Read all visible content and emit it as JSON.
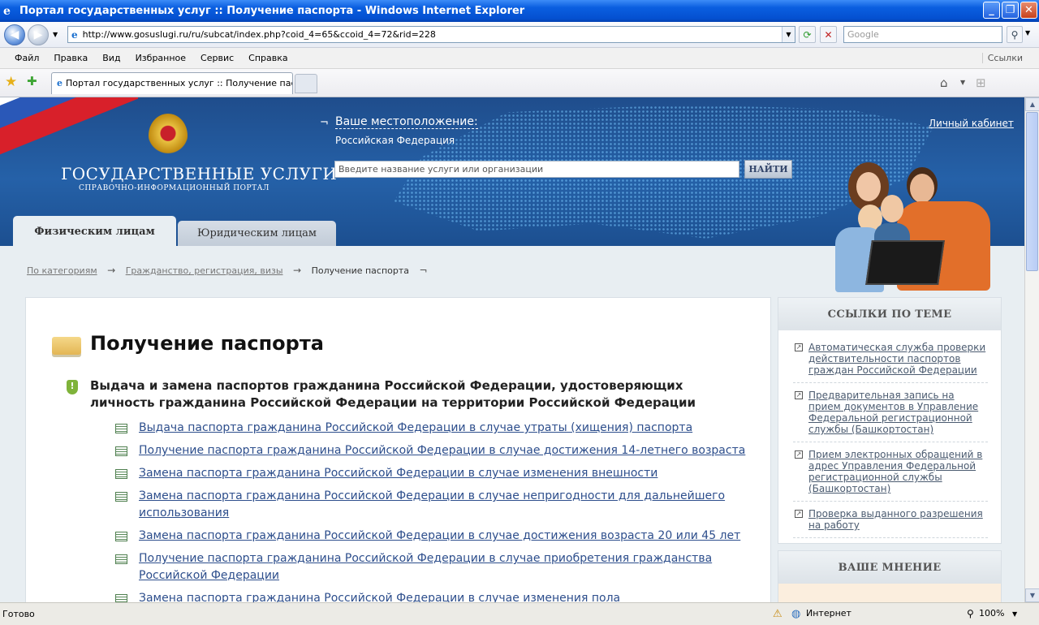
{
  "window": {
    "title": "Портал государственных услуг :: Получение паспорта - Windows Internet Explorer"
  },
  "browser": {
    "url": "http://www.gosuslugi.ru/ru/subcat/index.php?coid_4=65&ccoid_4=72&rid=228",
    "search_placeholder": "Google",
    "menu": [
      "Файл",
      "Правка",
      "Вид",
      "Избранное",
      "Сервис",
      "Справка"
    ],
    "links_label": "Ссылки",
    "tab_title": "Портал государственных услуг :: Получение пасп..."
  },
  "site": {
    "logo_title": "ГОСУДАРСТВЕННЫЕ УСЛУГИ",
    "logo_subtitle": "СПРАВОЧНО-ИНФОРМАЦИОННЫЙ ПОРТАЛ",
    "location_label": "Ваше местоположение:",
    "location_value": "Российская Федерация",
    "cabinet_link": "Личный кабинет",
    "search_placeholder": "Введите название услуги или организации",
    "search_button": "НАЙТИ",
    "tabs": [
      {
        "label": "Физическим лицам",
        "active": true
      },
      {
        "label": "Юридическим лицам",
        "active": false
      }
    ]
  },
  "breadcrumb": {
    "items": [
      "По категориям",
      "Гражданство, регистрация, визы"
    ],
    "current": "Получение паспорта"
  },
  "main": {
    "title": "Получение паспорта",
    "section_title": "Выдача и замена паспортов гражданина Российской Федерации, удостоверяющих личность гражданина Российской Федерации на территории Российской Федерации",
    "links": [
      "Выдача паспорта гражданина Российской Федерации в случае утраты (хищения) паспорта",
      "Получение паспорта гражданина Российской Федерации в случае достижения 14-летнего возраста",
      "Замена паспорта гражданина Российской Федерации в случае изменения внешности",
      "Замена паспорта гражданина Российской Федерации в случае непригодности для дальнейшего использования",
      "Замена паспорта гражданина Российской Федерации в случае достижения возраста 20 или 45 лет",
      "Получение паспорта гражданина Российской Федерации в случае приобретения гражданства Российской Федерации",
      "Замена паспорта гражданина Российской Федерации в случае изменения пола"
    ]
  },
  "sidebar": {
    "links_title": "ССЫЛКИ ПО ТЕМЕ",
    "links": [
      "Автоматическая служба проверки действительности паспортов граждан Российской Федерации",
      "Предварительная запись на прием документов в Управление Федеральной регистрационной службы (Башкортостан)",
      "Прием электронных обращений в адрес Управления Федеральной регистрационной службы (Башкортостан)",
      "Проверка выданного разрешения на работу"
    ],
    "opinion_title": "ВАШЕ МНЕНИЕ"
  },
  "status": {
    "text": "Готово",
    "zone": "Интернет",
    "zoom": "100%"
  },
  "colors": {
    "header_blue": "#2561a8",
    "link": "#2d4e8c",
    "titlebar": "#0a5ee0"
  }
}
